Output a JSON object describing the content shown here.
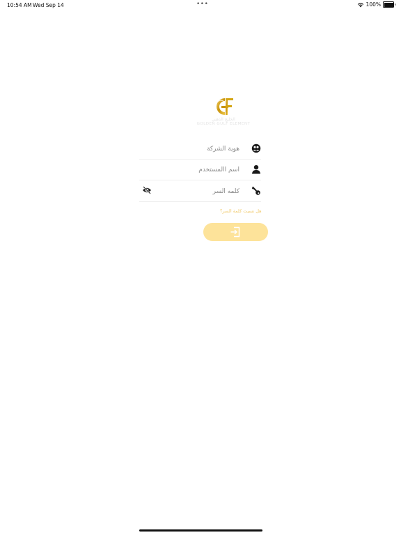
{
  "status_bar": {
    "time": "10:54 AM",
    "date": "Wed Sep 14",
    "dots": "•••",
    "battery_percent": "100%",
    "battery_level": 1.0,
    "icons": [
      "wifi-icon",
      "battery-icon"
    ]
  },
  "logo": {
    "arabic_text": "الخليج الذهبي",
    "english_text": "GOLDEN GULF ELEMENT",
    "colors": {
      "gold": "#d4a514",
      "silver": "#b8b8b8"
    }
  },
  "form": {
    "company_id": {
      "placeholder": "هوية الشركة",
      "value": "",
      "icon": "company-id-icon"
    },
    "username": {
      "placeholder": "اسم االمستخدم",
      "value": "",
      "icon": "user-icon"
    },
    "password": {
      "placeholder": "كلمه السر",
      "value": "",
      "icon": "key-icon",
      "toggle_icon": "eye-slash-icon"
    },
    "forgot_password": "هل نسيت كلمة السر؟",
    "login_icon": "sign-in-icon"
  },
  "colors": {
    "accent": "#fde39a",
    "link": "#f0c96a",
    "divider": "#eeeeee"
  }
}
